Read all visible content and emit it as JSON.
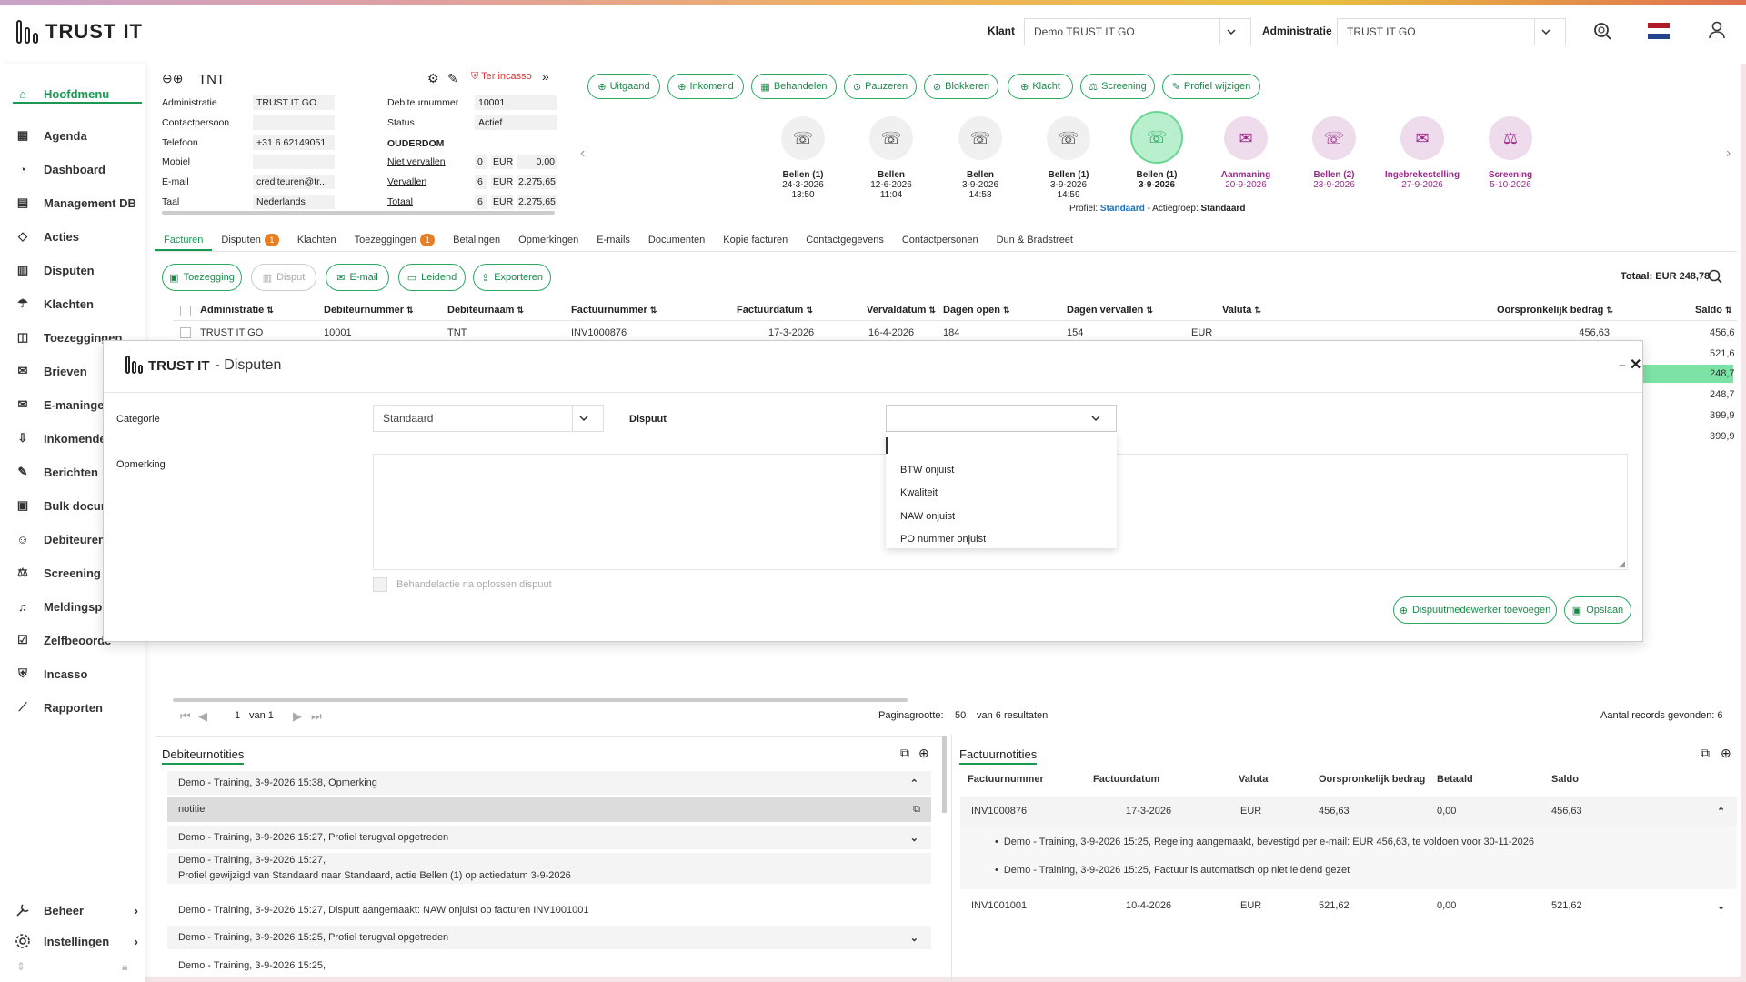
{
  "header": {
    "logo_text": "TRUST IT",
    "klant_label": "Klant",
    "klant_value": "Demo TRUST IT GO",
    "admin_label": "Administratie",
    "admin_value": "TRUST IT GO"
  },
  "sidebar": {
    "items": [
      {
        "label": "Hoofdmenu",
        "icon": "home-icon"
      },
      {
        "label": "Agenda",
        "icon": "calendar-icon"
      },
      {
        "label": "Dashboard",
        "icon": "dashboard-icon"
      },
      {
        "label": "Management DB",
        "icon": "management-icon"
      },
      {
        "label": "Acties",
        "icon": "actions-icon"
      },
      {
        "label": "Disputen",
        "icon": "dispute-icon"
      },
      {
        "label": "Klachten",
        "icon": "complaint-icon"
      },
      {
        "label": "Toezeggingen",
        "icon": "promise-icon"
      },
      {
        "label": "Brieven",
        "icon": "letter-icon"
      },
      {
        "label": "E-maningen",
        "icon": "email-icon"
      },
      {
        "label": "Inkomende",
        "icon": "incoming-icon"
      },
      {
        "label": "Berichten",
        "icon": "message-icon"
      },
      {
        "label": "Bulk docum",
        "icon": "bulk-icon"
      },
      {
        "label": "Debiteuren",
        "icon": "user-icon"
      },
      {
        "label": "Screening",
        "icon": "scale-icon"
      },
      {
        "label": "Meldingspli",
        "icon": "bell-icon"
      },
      {
        "label": "Zelfbeoorde",
        "icon": "self-icon"
      },
      {
        "label": "Incasso",
        "icon": "shield-icon"
      },
      {
        "label": "Rapporten",
        "icon": "chart-icon"
      }
    ],
    "beheer": "Beheer",
    "instellingen": "Instellingen"
  },
  "debtor": {
    "name": "TNT",
    "incasso_label": "Ter incasso",
    "fields": [
      {
        "label": "Administratie",
        "value": "TRUST IT GO"
      },
      {
        "label": "Contactpersoon",
        "value": ""
      },
      {
        "label": "Telefoon",
        "value": "+31 6 62149051"
      },
      {
        "label": "Mobiel",
        "value": ""
      },
      {
        "label": "E-mail",
        "value": "crediteuren@tr..."
      },
      {
        "label": "Taal",
        "value": "Nederlands"
      }
    ],
    "right_fields": [
      {
        "label": "Debiteurnummer",
        "value": "10001"
      },
      {
        "label": "Status",
        "value": "Actief"
      }
    ],
    "ouderdom_label": "OUDERDOM",
    "aging": [
      {
        "label": "Niet vervallen",
        "count": "0",
        "cur": "EUR",
        "amount": "0,00"
      },
      {
        "label": "Vervallen",
        "count": "6",
        "cur": "EUR",
        "amount": "2.275,65"
      },
      {
        "label": "Totaal",
        "count": "6",
        "cur": "EUR",
        "amount": "2.275,65"
      }
    ]
  },
  "action_pills": [
    "Uitgaand",
    "Inkomend",
    "Behandelen",
    "Pauzeren",
    "Blokkeren",
    "Klacht",
    "Screening",
    "Profiel wijzigen"
  ],
  "timeline": [
    {
      "title": "Bellen (1)",
      "date": "24-3-2026",
      "time": "13:50"
    },
    {
      "title": "Bellen",
      "date": "12-6-2026",
      "time": "11:04"
    },
    {
      "title": "Bellen",
      "date": "3-9-2026",
      "time": "14:58"
    },
    {
      "title": "Bellen (1)",
      "date": "3-9-2026",
      "time": "14:59"
    },
    {
      "title": "Bellen (1)",
      "date": "3-9-2026",
      "time": ""
    },
    {
      "title": "Aanmaning",
      "date": "20-9-2026",
      "time": ""
    },
    {
      "title": "Bellen (2)",
      "date": "23-9-2026",
      "time": ""
    },
    {
      "title": "Ingebrekestelling",
      "date": "27-9-2026",
      "time": ""
    },
    {
      "title": "Screening",
      "date": "5-10-2026",
      "time": ""
    }
  ],
  "profile_line": {
    "prefix": "Profiel:",
    "profiel": "Standaard",
    "mid": "- Actiegroep:",
    "actiegroep": "Standaard"
  },
  "tabs": [
    {
      "label": "Facturen",
      "badge": ""
    },
    {
      "label": "Disputen",
      "badge": "1"
    },
    {
      "label": "Klachten",
      "badge": ""
    },
    {
      "label": "Toezeggingen",
      "badge": "1"
    },
    {
      "label": "Betalingen",
      "badge": ""
    },
    {
      "label": "Opmerkingen",
      "badge": ""
    },
    {
      "label": "E-mails",
      "badge": ""
    },
    {
      "label": "Documenten",
      "badge": ""
    },
    {
      "label": "Kopie facturen",
      "badge": ""
    },
    {
      "label": "Contactgegevens",
      "badge": ""
    },
    {
      "label": "Contactpersonen",
      "badge": ""
    },
    {
      "label": "Dun & Bradstreet",
      "badge": ""
    }
  ],
  "invoice_buttons": [
    "Toezegging",
    "Disput",
    "E-mail",
    "Leidend",
    "Exporteren"
  ],
  "totaal": "Totaal: EUR 248,78",
  "table": {
    "headers": [
      "Administratie",
      "Debiteurnummer",
      "Debiteurnaam",
      "Factuurnummer",
      "Factuurdatum",
      "Vervaldatum",
      "Dagen open",
      "Dagen vervallen",
      "Valuta",
      "Oorspronkelijk bedrag",
      "Saldo"
    ],
    "row": [
      "TRUST IT GO",
      "10001",
      "TNT",
      "INV1000876",
      "17-3-2026",
      "16-4-2026",
      "184",
      "154",
      "EUR",
      "456,63",
      "456,6"
    ],
    "right_saldos": [
      "521,6",
      "248,7",
      "248,7",
      "399,9",
      "399,9"
    ]
  },
  "modal": {
    "brand": "TRUST IT",
    "title": "- Disputen",
    "categorie_label": "Categorie",
    "categorie_value": "Standaard",
    "dispuut_label": "Dispuut",
    "opmerking_label": "Opmerking",
    "options": [
      "BTW onjuist",
      "Kwaliteit",
      "NAW onjuist",
      "PO nummer onjuist"
    ],
    "checkbox_label": "Behandelactie na oplossen dispuut",
    "add_btn": "Dispuutmedewerker toevoegen",
    "save_btn": "Opslaan"
  },
  "pagination": {
    "page": "1",
    "of": "van 1",
    "size_label": "Paginagrootte:",
    "size": "50",
    "results": "van 6 resultaten",
    "found": "Aantal records gevonden: 6"
  },
  "debtor_notes": {
    "title": "Debiteurnotities",
    "rows": [
      "Demo - Training, 3-9-2026 15:38, Opmerking",
      "notitie",
      "Demo - Training, 3-9-2026 15:27, Profiel terugval opgetreden",
      "Demo - Training, 3-9-2026 15:27,",
      "Profiel gewijzigd van Standaard naar Standaard, actie Bellen (1) op actiedatum 3-9-2026",
      "Demo - Training, 3-9-2026 15:27, Disputt aangemaakt: NAW onjuist op facturen INV1001001",
      "Demo - Training, 3-9-2026 15:25, Profiel terugval opgetreden",
      "Demo - Training, 3-9-2026 15:25,"
    ]
  },
  "invoice_notes": {
    "title": "Factuurnotities",
    "headers": [
      "Factuurnummer",
      "Factuurdatum",
      "Valuta",
      "Oorspronkelijk bedrag",
      "Betaald",
      "Saldo"
    ],
    "rows": [
      [
        "INV1000876",
        "17-3-2026",
        "EUR",
        "456,63",
        "0,00",
        "456,63"
      ],
      [
        "INV1001001",
        "10-4-2026",
        "EUR",
        "521,62",
        "0,00",
        "521,62"
      ]
    ],
    "bullets": [
      "Demo - Training, 3-9-2026 15:25, Regeling aangemaakt, bevestigd per e-mail: EUR 456,63, te voldoen voor 30-11-2026",
      "Demo - Training, 3-9-2026 15:25, Factuur is automatisch op niet leidend gezet"
    ]
  }
}
